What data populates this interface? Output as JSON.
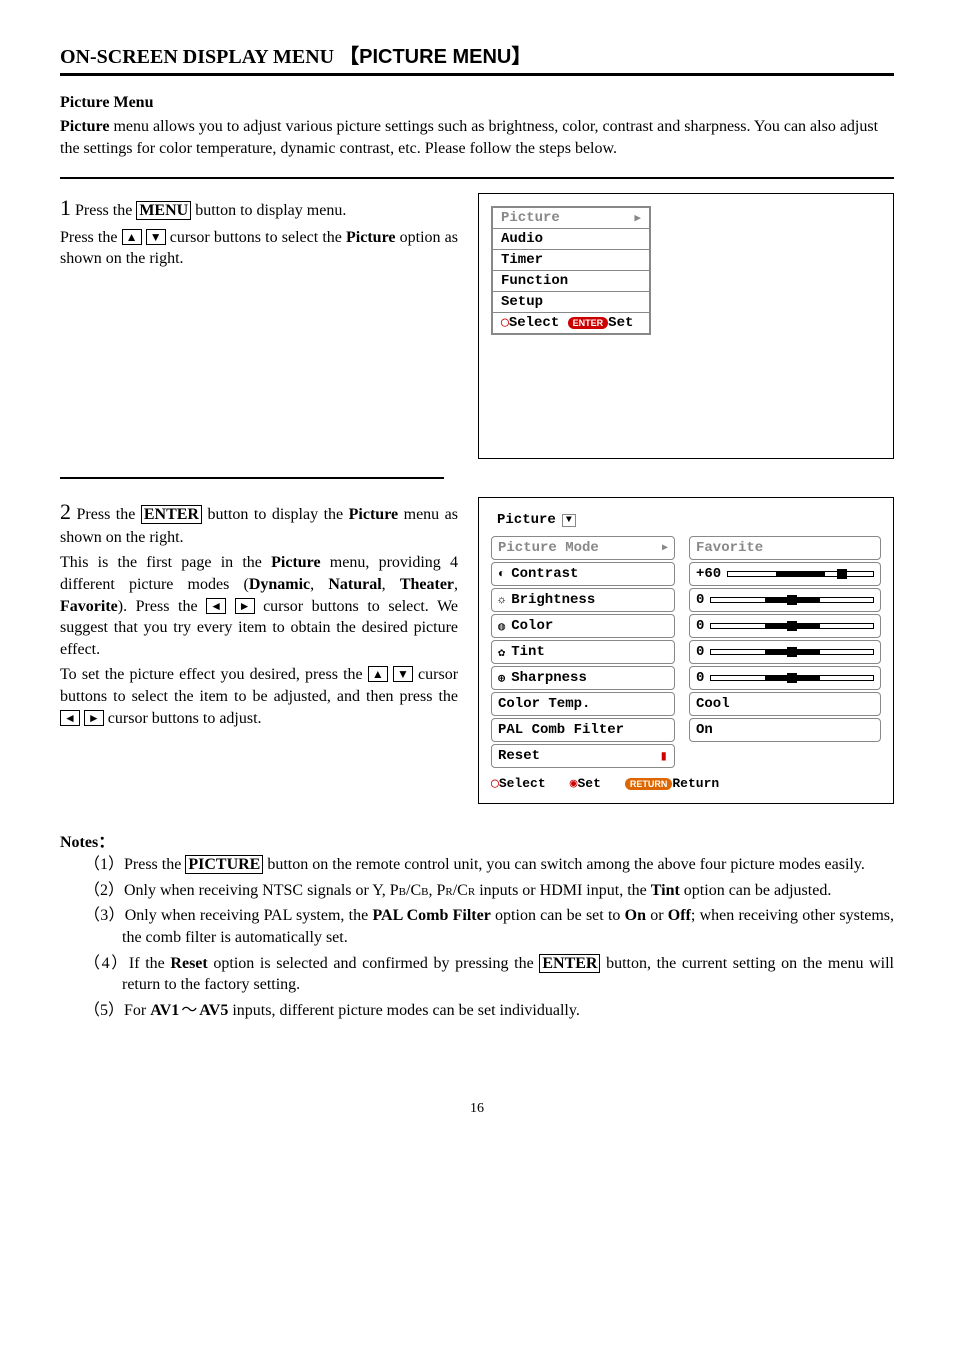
{
  "header": {
    "title_prefix": "ON-SCREEN DISPLAY MENU",
    "title_bracket": "【PICTURE MENU】"
  },
  "intro": {
    "subhead": "Picture Menu",
    "p1a": "Picture",
    "p1b": " menu allows you to adjust various picture settings such as brightness, color, contrast and sharpness. You can also adjust the settings for color temperature, dynamic contrast, etc. Please follow the steps below."
  },
  "step1": {
    "numtext": "1",
    "l1a": " Press the ",
    "l1b": "MENU",
    "l1c": " button to display menu.",
    "l2a": "Press the ",
    "up": "▲",
    "dn": "▼",
    "l2b": " cursor buttons to select the ",
    "l2c": "Picture",
    "l2d": " option as shown on the right."
  },
  "osd1": {
    "items": [
      "Picture",
      "Audio",
      "Timer",
      "Function",
      "Setup"
    ],
    "select": "Select",
    "enter_pill": "ENTER",
    "set": "Set"
  },
  "step2": {
    "numtext": "2",
    "l1a": " Press the ",
    "l1b": "ENTER",
    "l1c": " button to display the ",
    "l1d": "Picture",
    "l1e": " menu as shown on the right.",
    "p2a": "This is the first page in the ",
    "p2b": "Picture",
    "p2c": " menu, providing 4 different picture modes (",
    "p2d": "Dynamic",
    "p2e": ", ",
    "p2f": "Natural",
    "p2g": ", ",
    "p2h": "Theater",
    "p2i": ", ",
    "p2j": "Favorite",
    "p2k": "). Press the ",
    "lt": "◄",
    "rt": "►",
    "p2l": " cursor buttons to select. We suggest that you try every item to obtain the desired picture effect.",
    "p3a": "To set the picture effect you desired, press the ",
    "p3b": " cursor buttons to select the item to be adjusted, and then press the ",
    "p3c": " cursor buttons to adjust."
  },
  "osd2": {
    "title": "Picture",
    "rows": [
      {
        "label": "Picture Mode",
        "icon": "",
        "val": "Favorite",
        "dimRight": true,
        "hasTri": true,
        "dimLeft": true
      },
      {
        "label": "Contrast",
        "icon": "◐",
        "val": "+60",
        "slider": true,
        "pos": 78
      },
      {
        "label": "Brightness",
        "icon": "☼",
        "val": "0",
        "slider": true,
        "pos": 50
      },
      {
        "label": "Color",
        "icon": "◍",
        "val": "0",
        "slider": true,
        "pos": 50
      },
      {
        "label": "Tint",
        "icon": "✿",
        "val": "0",
        "slider": true,
        "pos": 50
      },
      {
        "label": "Sharpness",
        "icon": "⊕",
        "val": "0",
        "slider": true,
        "pos": 50
      },
      {
        "label": "Color Temp.",
        "icon": "",
        "val": "Cool"
      },
      {
        "label": "PAL Comb Filter",
        "icon": "",
        "val": "On"
      },
      {
        "label": "Reset",
        "icon": "",
        "val": "",
        "warn": true
      }
    ],
    "select": "Select",
    "set": "Set",
    "return_pill": "RETURN",
    "return": "Return"
  },
  "notes": {
    "head": "Notes：",
    "n1a": "（1）Press the ",
    "n1b": "PICTURE",
    "n1c": " button on the remote control unit, you can switch among the above four picture modes easily.",
    "n2a": "（2）Only when receiving NTSC signals or Y, P",
    "n2b1": "B",
    "n2b": "/C",
    "n2c1": "B",
    "n2c": ", P",
    "n2d1": "R",
    "n2d": "/C",
    "n2e1": "R",
    "n2e": " inputs or HDMI input, the ",
    "n2f": "Tint",
    "n2g": " option can be adjusted.",
    "n3a": "（3）Only when receiving PAL system, the ",
    "n3b": "PAL Comb Filter",
    "n3c": " option can be set to ",
    "n3d": "On",
    "n3e": " or ",
    "n3f": "Off",
    "n3g": "; when receiving other systems, the comb filter is automatically set.",
    "n4a": "（4）If the ",
    "n4b": "Reset",
    "n4c": " option is selected and confirmed by pressing the ",
    "n4d": "ENTER",
    "n4e": " button, the current setting on the menu will return to the factory setting.",
    "n5a": "（5）For ",
    "n5b": "AV1",
    "n5t": "～",
    "n5c": "AV5",
    "n5d": " inputs, different picture modes can be set individually."
  },
  "pagenum": "16"
}
